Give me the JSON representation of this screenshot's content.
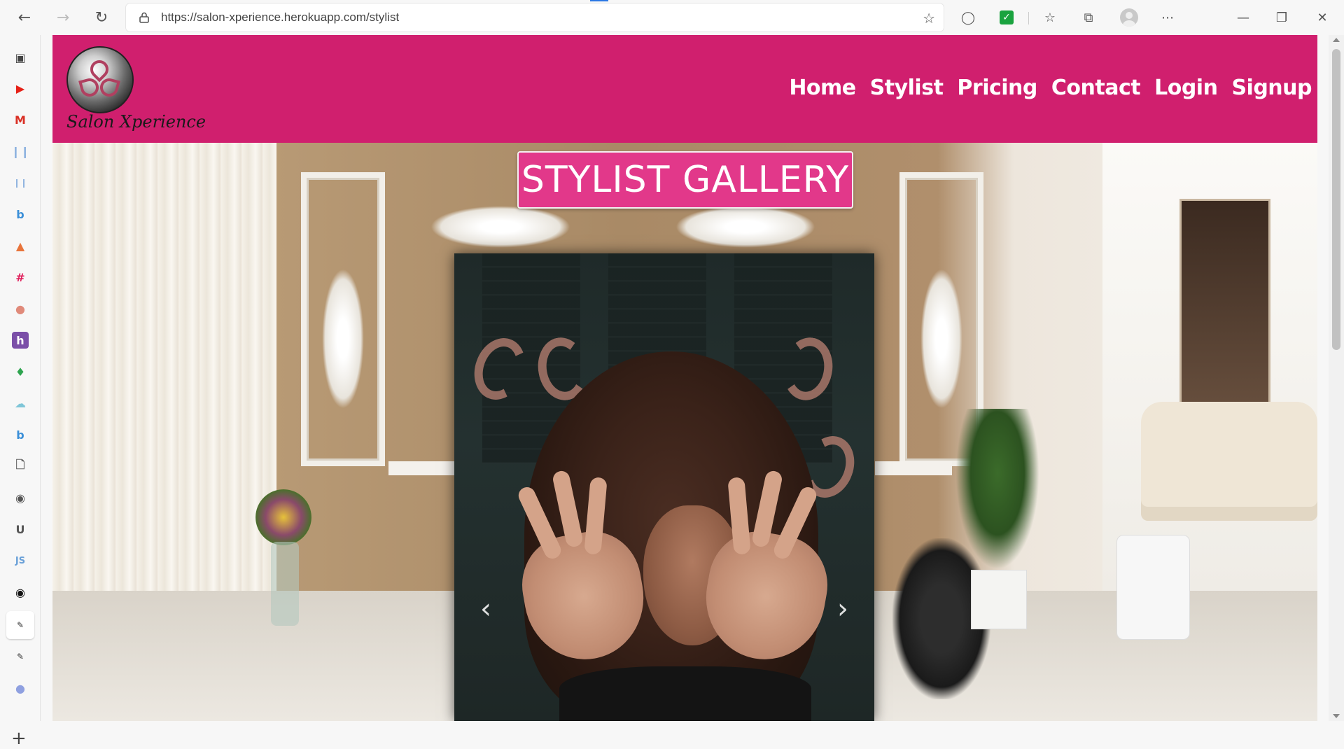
{
  "browser": {
    "url": "https://salon-xperience.herokuapp.com/stylist"
  },
  "site": {
    "logo_text": "Salon Xperience",
    "nav": [
      "Home",
      "Stylist",
      "Pricing",
      "Contact",
      "Login",
      "Signup"
    ],
    "gallery_title": "STYLIST GALLERY",
    "brand_color": "#d01f6e",
    "title_color": "#e2388a"
  },
  "carousel": {
    "prev_label": "‹",
    "next_label": "›"
  },
  "sidebar": {
    "icons": [
      "tabs-icon",
      "youtube-icon",
      "gmail-icon",
      "library-icon",
      "library-icon",
      "bing-icon",
      "gitlab-icon",
      "slack-icon",
      "app-icon",
      "h-icon",
      "leaf-icon",
      "cloud-icon",
      "bing-icon",
      "document-icon",
      "discord-icon",
      "u-icon",
      "js-icon",
      "github-icon",
      "pin-icon",
      "pin-icon",
      "app-icon"
    ]
  }
}
